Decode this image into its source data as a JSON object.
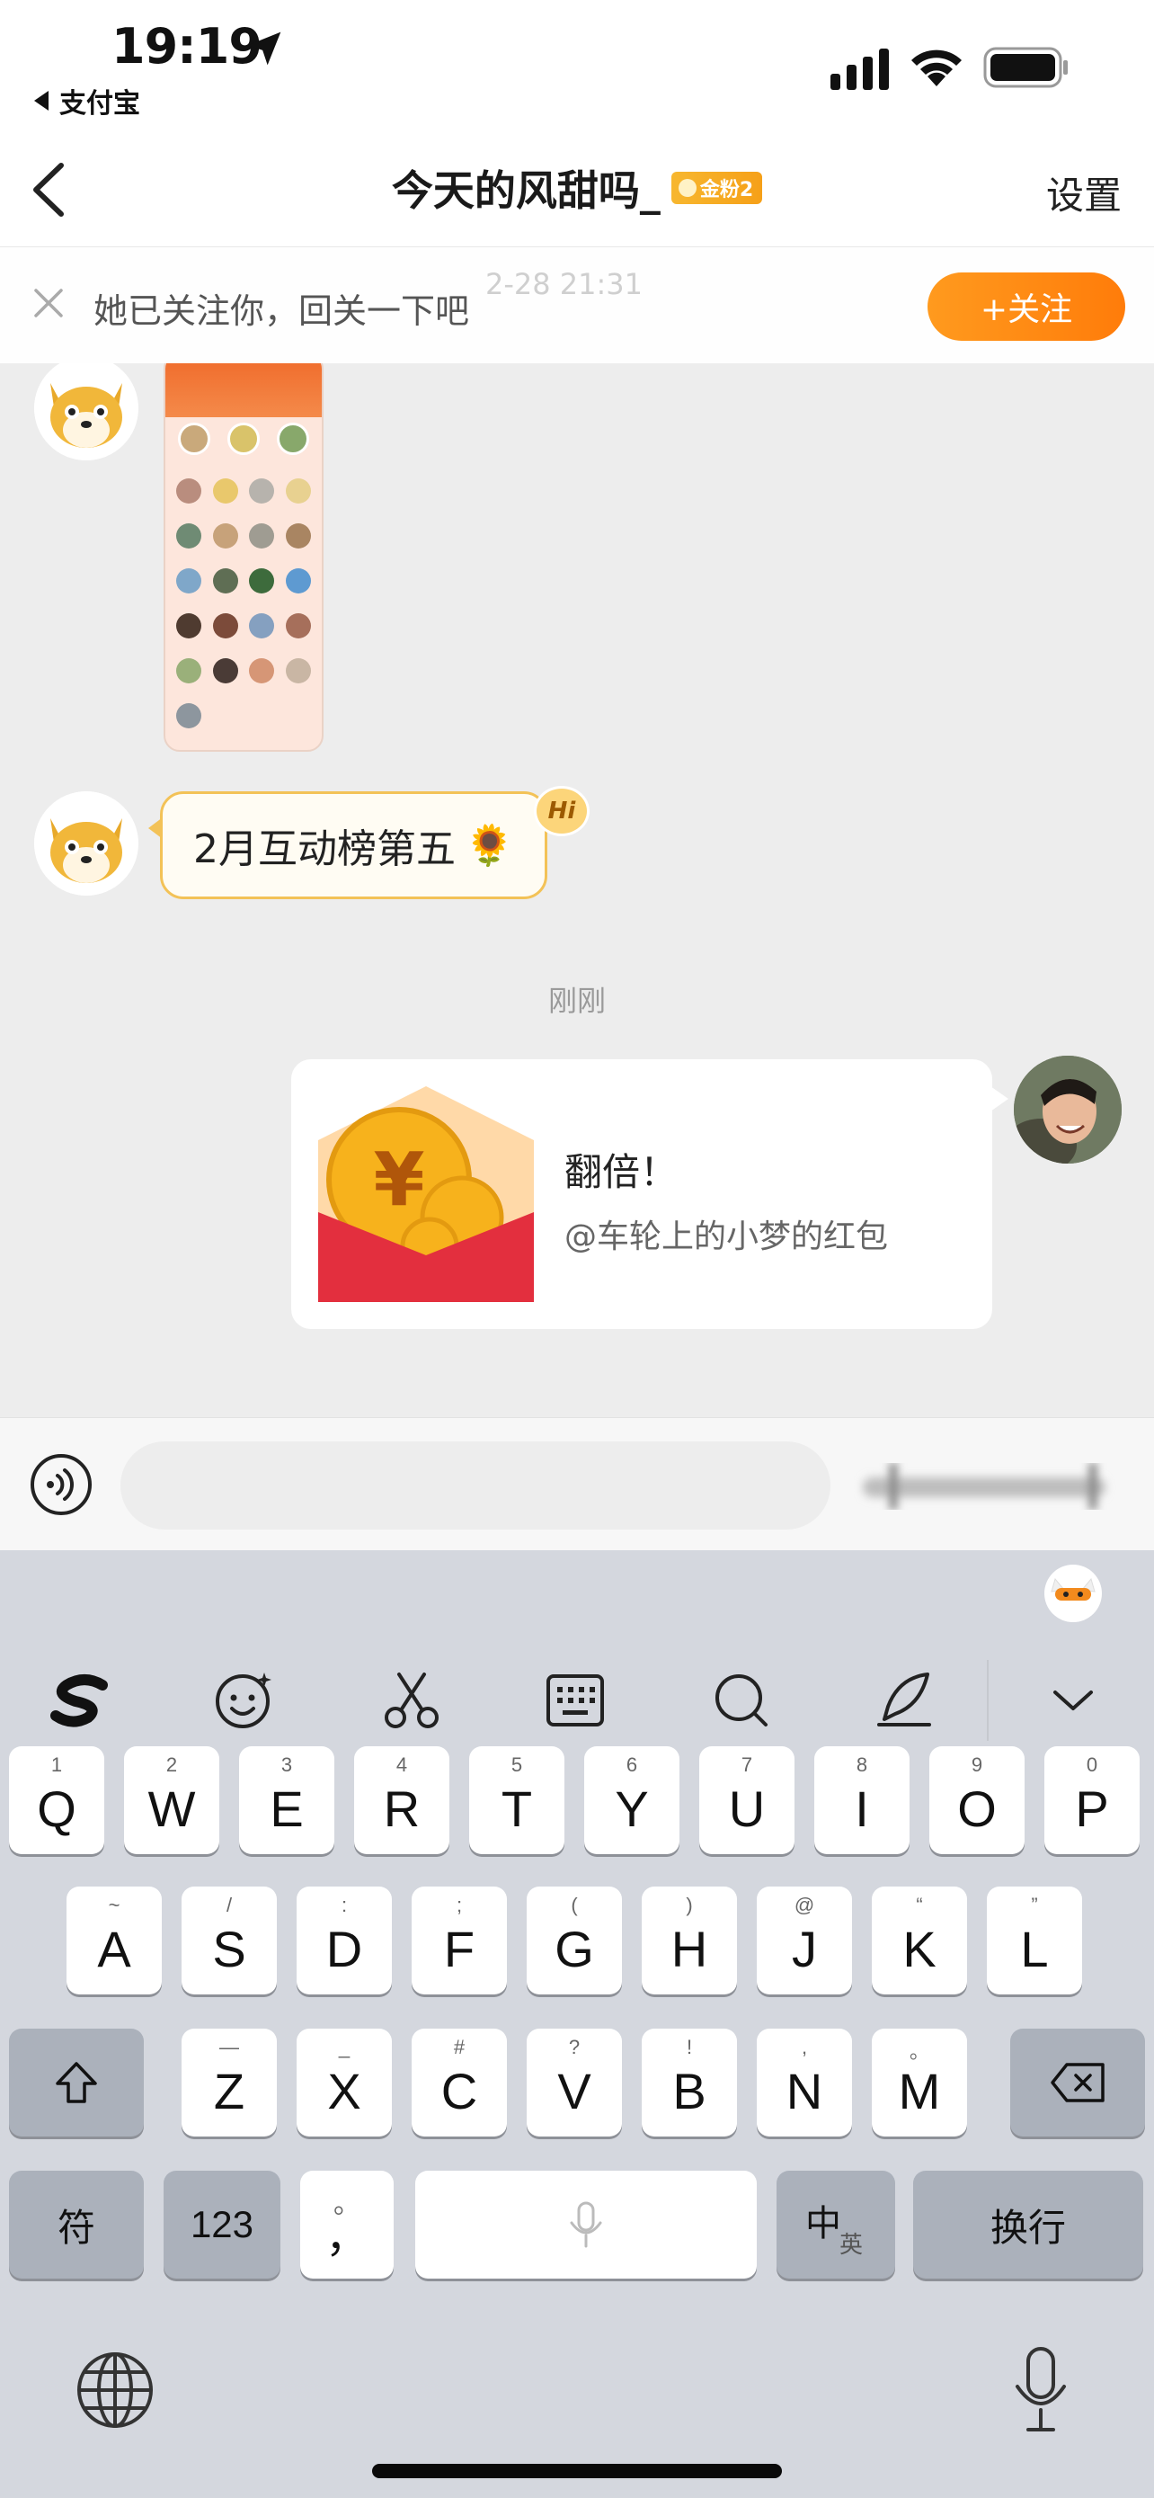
{
  "status_bar": {
    "time": "19:19",
    "back_app": "支付宝"
  },
  "nav": {
    "title": "今天的风甜吗_",
    "fan_badge": "金粉2",
    "settings": "设置"
  },
  "follow_bar": {
    "faded_time": "2-28 21:31",
    "text": "她已关注你，回关一下吧",
    "button": "+关注"
  },
  "messages": {
    "incoming_text": "2月互动榜第五",
    "incoming_emoji": "🌻",
    "hi_badge": "Hi",
    "time_separator": "刚刚",
    "red_packet": {
      "title": "翻倍！",
      "subtitle": "@车轮上的小梦的红包",
      "currency_symbol": "¥"
    }
  },
  "input": {
    "placeholder": ""
  },
  "keyboard": {
    "row1": [
      {
        "k": "Q",
        "s": "1"
      },
      {
        "k": "W",
        "s": "2"
      },
      {
        "k": "E",
        "s": "3"
      },
      {
        "k": "R",
        "s": "4"
      },
      {
        "k": "T",
        "s": "5"
      },
      {
        "k": "Y",
        "s": "6"
      },
      {
        "k": "U",
        "s": "7"
      },
      {
        "k": "I",
        "s": "8"
      },
      {
        "k": "O",
        "s": "9"
      },
      {
        "k": "P",
        "s": "0"
      }
    ],
    "row2": [
      {
        "k": "A",
        "s": "~"
      },
      {
        "k": "S",
        "s": "/"
      },
      {
        "k": "D",
        "s": ":"
      },
      {
        "k": "F",
        "s": ";"
      },
      {
        "k": "G",
        "s": "("
      },
      {
        "k": "H",
        "s": ")"
      },
      {
        "k": "J",
        "s": "@"
      },
      {
        "k": "K",
        "s": "“"
      },
      {
        "k": "L",
        "s": "”"
      }
    ],
    "row3": [
      {
        "k": "Z",
        "s": "—"
      },
      {
        "k": "X",
        "s": "_"
      },
      {
        "k": "C",
        "s": "#"
      },
      {
        "k": "V",
        "s": "?"
      },
      {
        "k": "B",
        "s": "!"
      },
      {
        "k": "N",
        "s": ","
      },
      {
        "k": "M",
        "s": "。"
      }
    ],
    "symbols_key": "符",
    "numbers_key": "123",
    "punct_key_main": "，",
    "punct_key_sub": "。",
    "lang_key_main": "中",
    "lang_key_sub": "英",
    "return_key": "换行"
  }
}
